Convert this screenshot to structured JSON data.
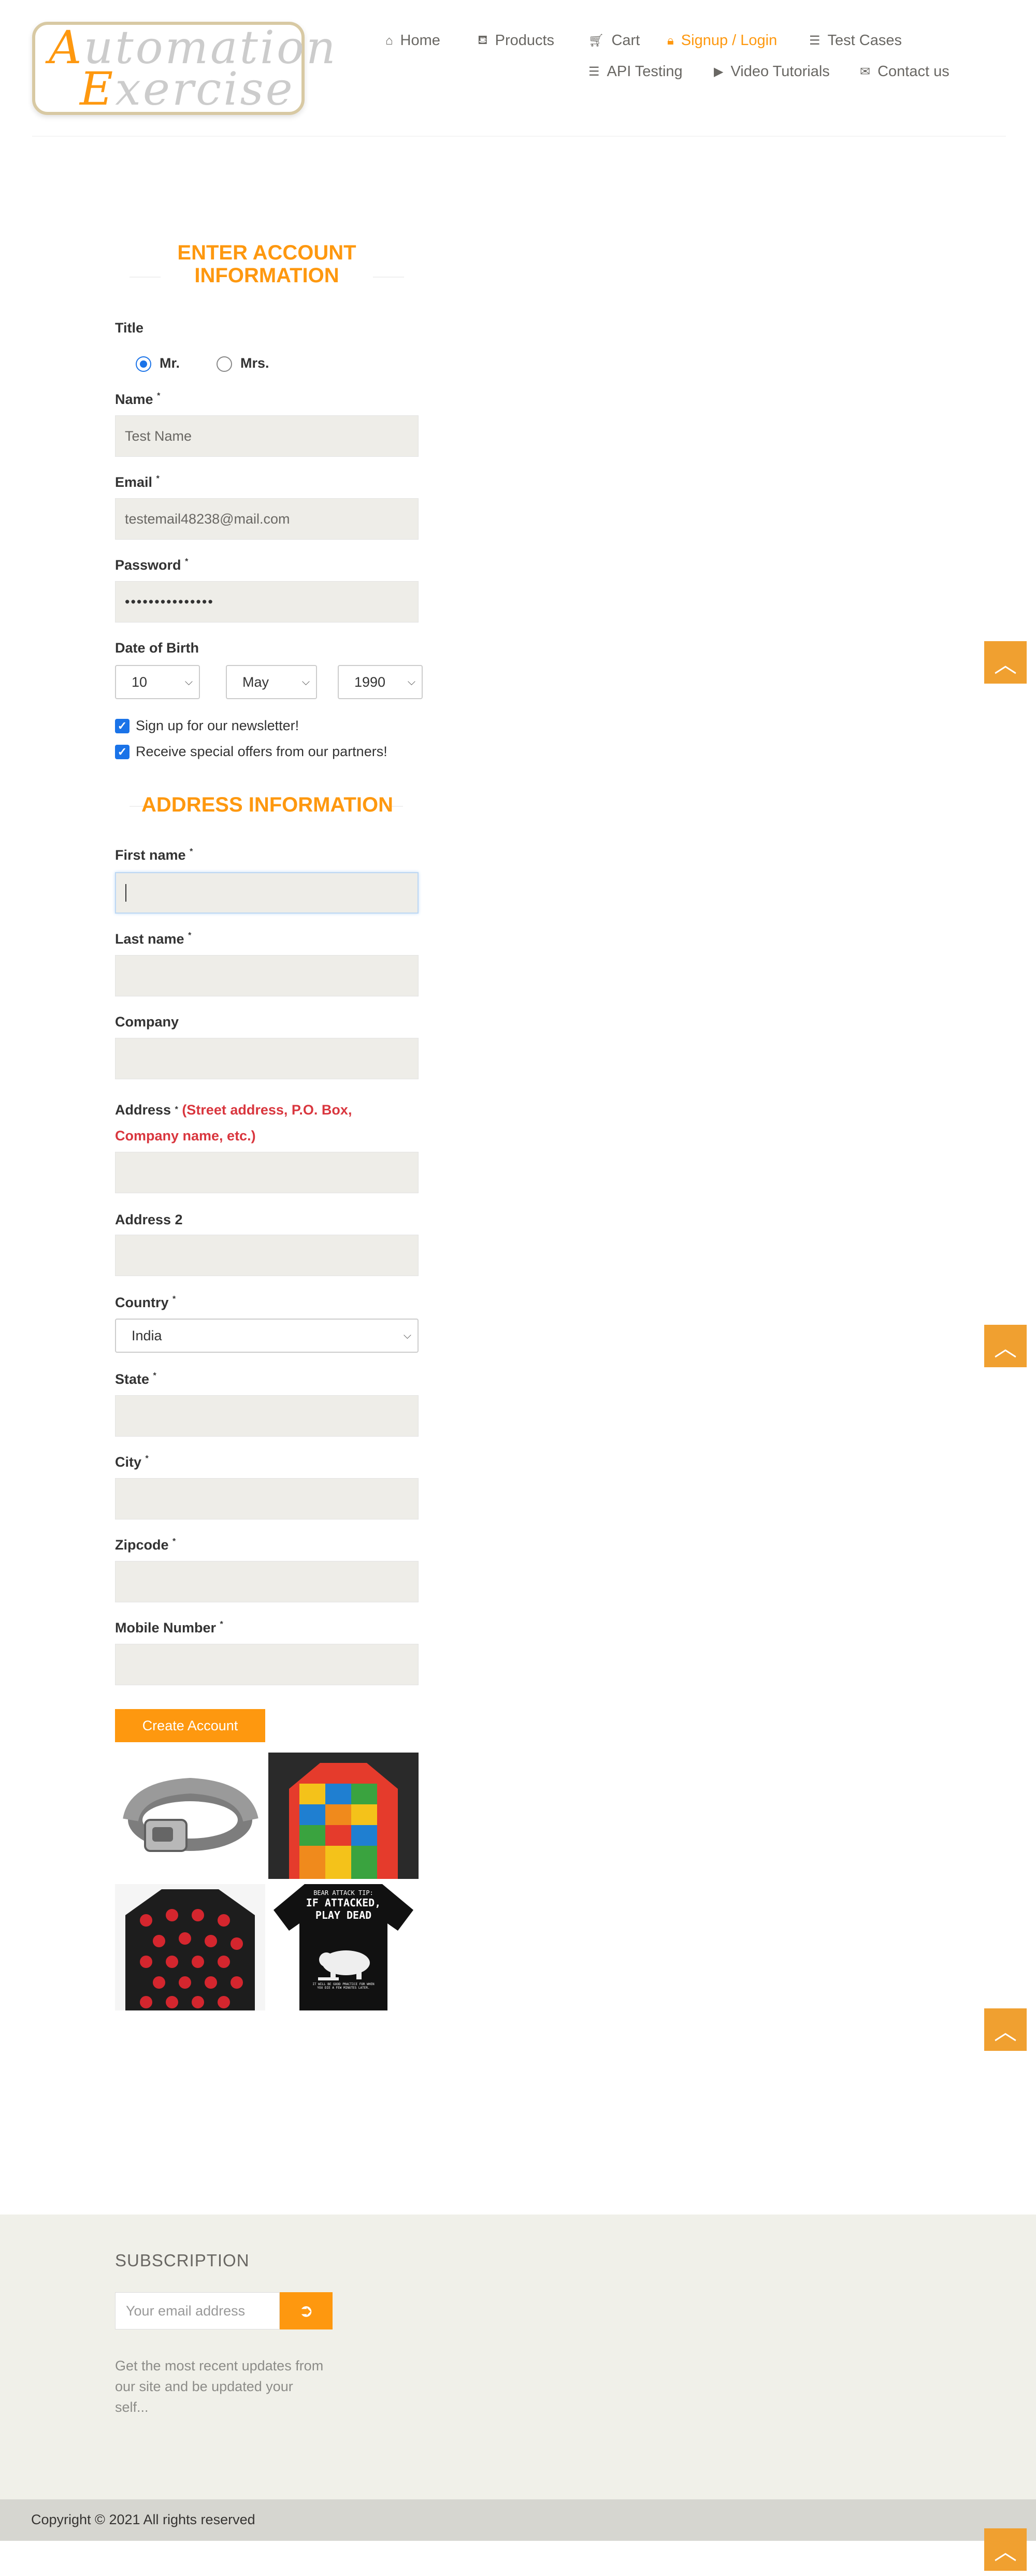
{
  "header": {
    "logo": {
      "line1_cap": "A",
      "line1_rest": "utomation",
      "line2_cap": "E",
      "line2_rest": "xercise"
    },
    "nav": [
      {
        "label": "Home",
        "icon": "home-icon"
      },
      {
        "label": "Products",
        "icon": "shirt-icon"
      },
      {
        "label": "Cart",
        "icon": "cart-icon"
      },
      {
        "label": "Signup / Login",
        "icon": "lock-icon",
        "active": true
      },
      {
        "label": "Test Cases",
        "icon": "list-icon"
      },
      {
        "label": "API Testing",
        "icon": "list-icon"
      },
      {
        "label": "Video Tutorials",
        "icon": "youtube-icon"
      },
      {
        "label": "Contact us",
        "icon": "envelope-icon"
      }
    ]
  },
  "account": {
    "heading_line1": "ENTER ACCOUNT",
    "heading_line2": "INFORMATION",
    "title_label": "Title",
    "title_options": [
      "Mr.",
      "Mrs."
    ],
    "title_selected": "Mr.",
    "name_label": "Name",
    "name_value": "Test Name",
    "email_label": "Email",
    "email_value": "testemail48238@mail.com",
    "password_label": "Password",
    "password_value": "•••••••••••••••",
    "dob_label": "Date of Birth",
    "dob_day": "10",
    "dob_month": "May",
    "dob_year": "1990",
    "newsletter_label": "Sign up for our newsletter!",
    "offers_label": "Receive special offers from our partners!",
    "required_mark": "*"
  },
  "address": {
    "heading": "ADDRESS INFORMATION",
    "first_name_label": "First name",
    "last_name_label": "Last name",
    "company_label": "Company",
    "address_label": "Address",
    "address_note_line1": "(Street address, P.O. Box,",
    "address_note_line2": "Company name, etc.)",
    "address2_label": "Address 2",
    "country_label": "Country",
    "country_value": "India",
    "state_label": "State",
    "city_label": "City",
    "zipcode_label": "Zipcode",
    "mobile_label": "Mobile Number",
    "create_button": "Create Account"
  },
  "ads": {
    "tshirt_text_line1": "BEAR ATTACK TIP:",
    "tshirt_text_line2": "IF ATTACKED,",
    "tshirt_text_line3": "PLAY DEAD",
    "tshirt_small_line1": "IT WILL BE GOOD PRACTICE FOR WHEN",
    "tshirt_small_line2": "YOU DIE A FEW MINUTES LATER."
  },
  "footer": {
    "subscription_title": "SUBSCRIPTION",
    "email_placeholder": "Your email address",
    "subscribe_icon": "arrow-circle-right-icon",
    "text_line1": "Get the most recent updates from",
    "text_line2": "our site and be updated your",
    "text_line3": "self...",
    "copyright": "Copyright © 2021 All rights reserved"
  },
  "colors": {
    "accent": "#fe980f",
    "field_bg": "#eeede8",
    "footer_bg": "#f0f0e9",
    "copyright_bg": "#d6d6d0",
    "error_red": "#d9363e",
    "checkbox_blue": "#1a73e8"
  }
}
